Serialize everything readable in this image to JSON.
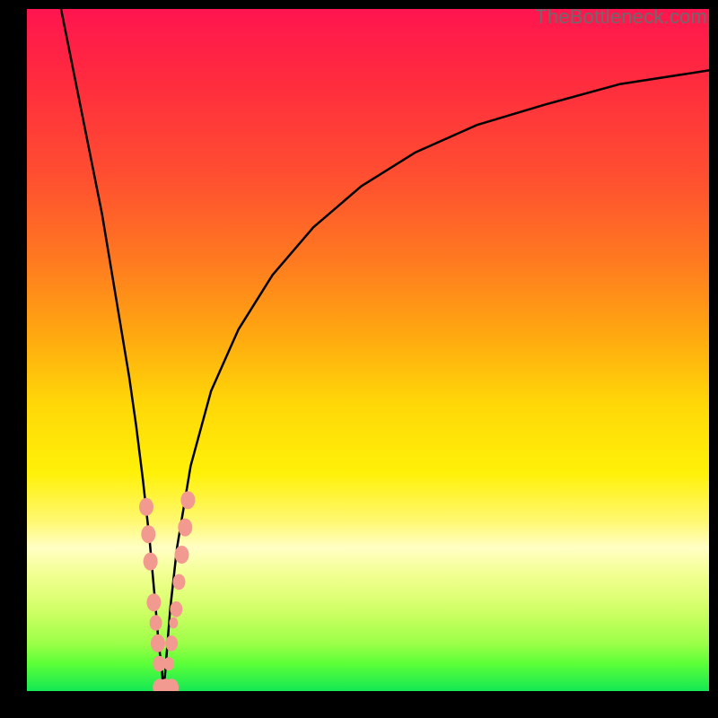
{
  "watermark": "TheBottleneck.com",
  "chart_data": {
    "type": "line",
    "title": "",
    "xlabel": "",
    "ylabel": "",
    "xlim": [
      0,
      100
    ],
    "ylim": [
      0,
      100
    ],
    "legend": false,
    "grid": false,
    "series": [
      {
        "name": "bottleneck-curve",
        "x": [
          5,
          7,
          9,
          11,
          13,
          15,
          16,
          17,
          18,
          18.8,
          19.3,
          19.8,
          20.0,
          20.3,
          20.6,
          21.0,
          22.0,
          24.0,
          27.0,
          31.0,
          36.0,
          42.0,
          49.0,
          57.0,
          66.0,
          76.0,
          87.0,
          100.0
        ],
        "values": [
          100,
          90,
          80,
          70,
          58,
          46,
          39,
          31,
          22,
          13,
          7,
          3,
          0,
          3,
          7,
          12,
          21,
          33,
          44,
          53,
          61,
          68,
          74,
          79,
          83,
          86,
          89,
          91
        ]
      }
    ],
    "markers": {
      "name": "highlight-points",
      "color": "#f29a8f",
      "points": [
        {
          "x": 17.5,
          "y": 27,
          "r": 8
        },
        {
          "x": 17.8,
          "y": 23,
          "r": 8
        },
        {
          "x": 18.1,
          "y": 19,
          "r": 8
        },
        {
          "x": 18.6,
          "y": 13,
          "r": 8
        },
        {
          "x": 18.9,
          "y": 10,
          "r": 7
        },
        {
          "x": 19.2,
          "y": 7,
          "r": 8
        },
        {
          "x": 19.4,
          "y": 4,
          "r": 7
        },
        {
          "x": 19.5,
          "y": 0.5,
          "r": 8
        },
        {
          "x": 20.3,
          "y": 0.5,
          "r": 8
        },
        {
          "x": 21.2,
          "y": 0.5,
          "r": 8
        },
        {
          "x": 20.8,
          "y": 4,
          "r": 6
        },
        {
          "x": 21.2,
          "y": 7,
          "r": 7
        },
        {
          "x": 21.5,
          "y": 10,
          "r": 5
        },
        {
          "x": 21.9,
          "y": 12,
          "r": 7
        },
        {
          "x": 22.3,
          "y": 16,
          "r": 7
        },
        {
          "x": 22.7,
          "y": 20,
          "r": 8
        },
        {
          "x": 23.2,
          "y": 24,
          "r": 8
        },
        {
          "x": 23.6,
          "y": 28,
          "r": 8
        }
      ]
    },
    "background": {
      "type": "vertical-gradient",
      "stops": [
        {
          "pos": 0,
          "color": "#ff154f"
        },
        {
          "pos": 0.5,
          "color": "#ffd808"
        },
        {
          "pos": 0.8,
          "color": "#ffffc5"
        },
        {
          "pos": 1.0,
          "color": "#14e854"
        }
      ]
    }
  }
}
